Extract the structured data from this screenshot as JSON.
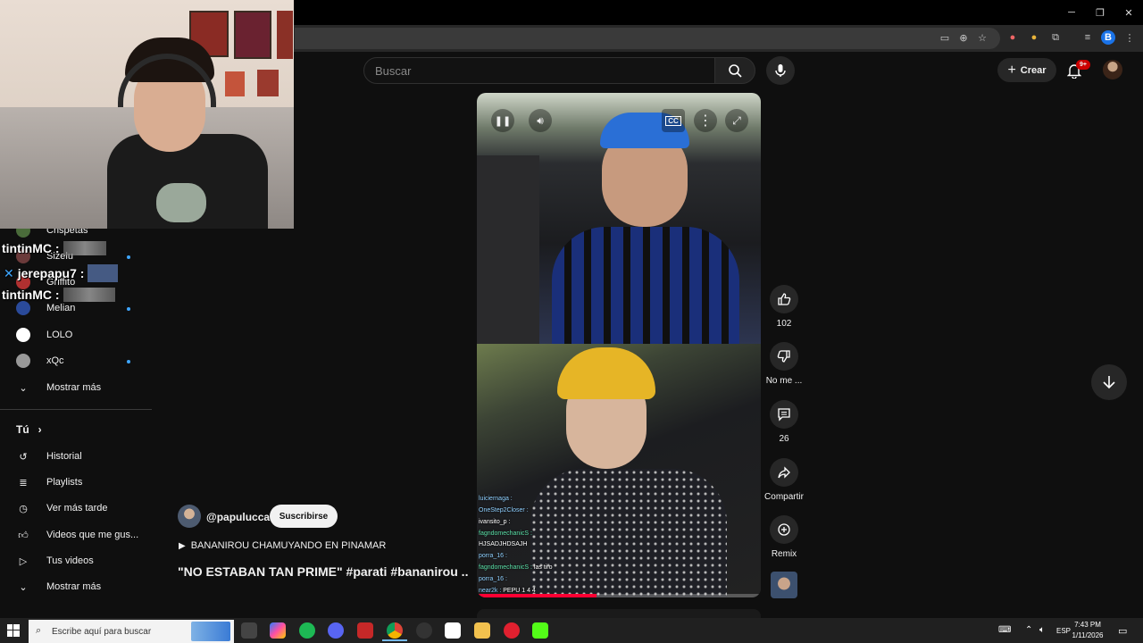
{
  "browser": {
    "window_controls": [
      "─",
      "❐",
      "✕"
    ],
    "profile_initial": "B"
  },
  "header": {
    "search_placeholder": "Buscar",
    "create_label": "Crear",
    "notifications_badge": "9+"
  },
  "sidebar": {
    "channels": [
      {
        "name": "Crispetas"
      },
      {
        "name": "Sizelu"
      },
      {
        "name": "Griffito"
      },
      {
        "name": "Melian"
      },
      {
        "name": "LOLO"
      },
      {
        "name": "xQc"
      }
    ],
    "show_more": "Mostrar más",
    "you_section": "Tú",
    "you_items": [
      {
        "label": "Historial",
        "icon": "history-icon"
      },
      {
        "label": "Playlists",
        "icon": "playlist-icon"
      },
      {
        "label": "Ver más tarde",
        "icon": "watch-later-icon"
      },
      {
        "label": "Videos que me gus...",
        "icon": "like-icon"
      },
      {
        "label": "Tus videos",
        "icon": "your-videos-icon"
      }
    ],
    "show_more_2": "Mostrar más"
  },
  "overlay_chat": [
    {
      "user": "tintinMC :"
    },
    {
      "user": "jerepapu7 :"
    },
    {
      "user": "tintinMC :"
    }
  ],
  "short": {
    "channel": "@papulucca",
    "subscribe": "Suscribirse",
    "audio": "BANANIROU CHAMUYANDO EN PINAMAR",
    "title": "\"NO ESTABAN TAN PRIME\" #parati #bananirou ...",
    "progress": 0.42,
    "likes": "102",
    "dislike_label": "No me ...",
    "comments": "26",
    "share_label": "Compartir",
    "remix_label": "Remix"
  },
  "video_chat": [
    {
      "user": "luiciernaga :",
      "msg": ""
    },
    {
      "user": "OneStep2Closer :",
      "msg": ""
    },
    {
      "user": "ivansito_p :",
      "msg": ""
    },
    {
      "user": "fagndomechanicS :",
      "msg": ""
    },
    {
      "user": "",
      "msg": "HJSADJHDSAJH"
    },
    {
      "user": "porra_16 :",
      "msg": ""
    },
    {
      "user": "fagndomechanicS :",
      "msg": "las tiro"
    },
    {
      "user": "porra_16 :",
      "msg": ""
    },
    {
      "user": "near2k :",
      "msg": "PEPU 1 4 4"
    }
  ],
  "taskbar": {
    "search_placeholder": "Escribe aquí para buscar",
    "lang": "ESP",
    "time": "7:43 PM",
    "date": "1/11/2026"
  }
}
